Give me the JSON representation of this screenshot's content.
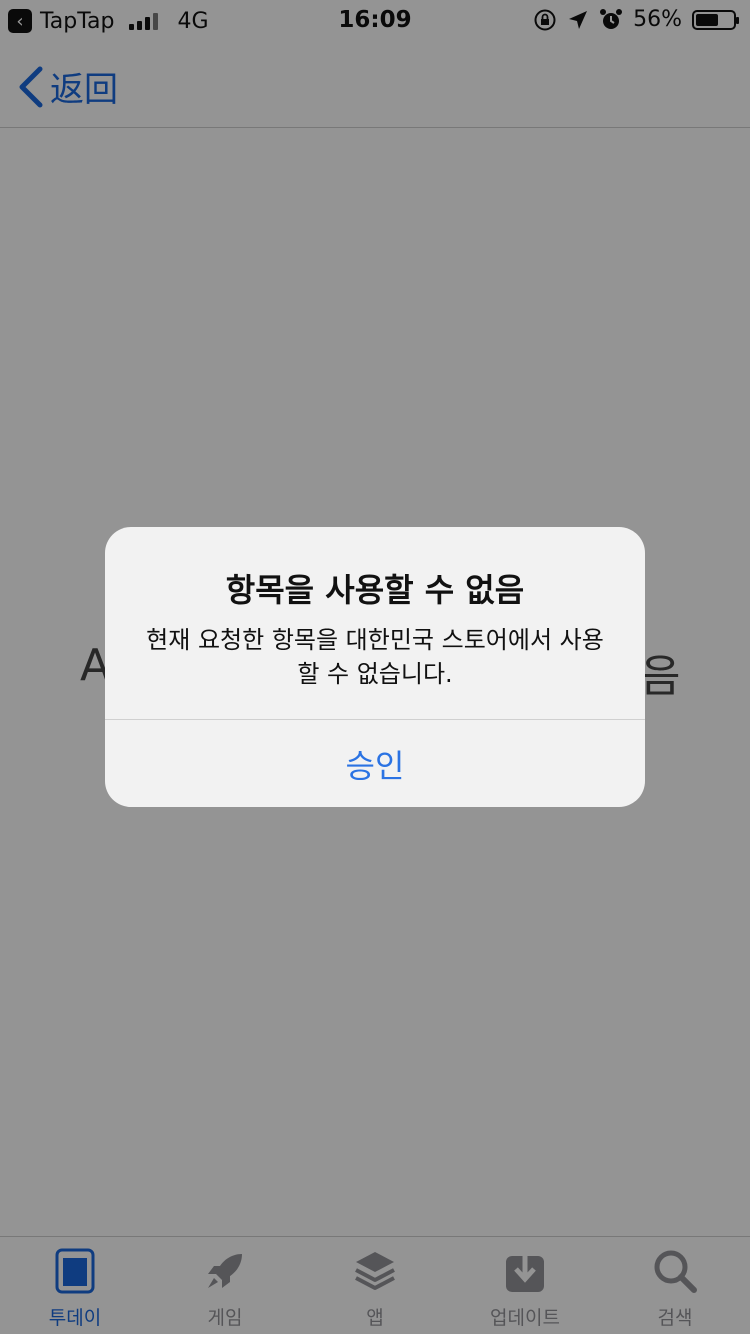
{
  "status_bar": {
    "carrier": "TapTap",
    "network": "4G",
    "time": "16:09",
    "battery": "56%"
  },
  "nav": {
    "back_label": "返回"
  },
  "background": {
    "hint_left": "A",
    "hint_right": "음"
  },
  "alert": {
    "title": "항목을 사용할 수 없음",
    "message_line1": "현재 요청한 항목을 대한민국 스토어에서 사용",
    "message_line2": "할 수 없습니다.",
    "button_label": "승인"
  },
  "tabs": [
    {
      "label": "투데이",
      "icon": "today-icon",
      "active": true
    },
    {
      "label": "게임",
      "icon": "rocket-icon",
      "active": false
    },
    {
      "label": "앱",
      "icon": "layers-icon",
      "active": false
    },
    {
      "label": "업데이트",
      "icon": "download-icon",
      "active": false
    },
    {
      "label": "검색",
      "icon": "search-icon",
      "active": false
    }
  ],
  "colors": {
    "accent": "#1a64d6",
    "inactive": "#8e8e93"
  }
}
